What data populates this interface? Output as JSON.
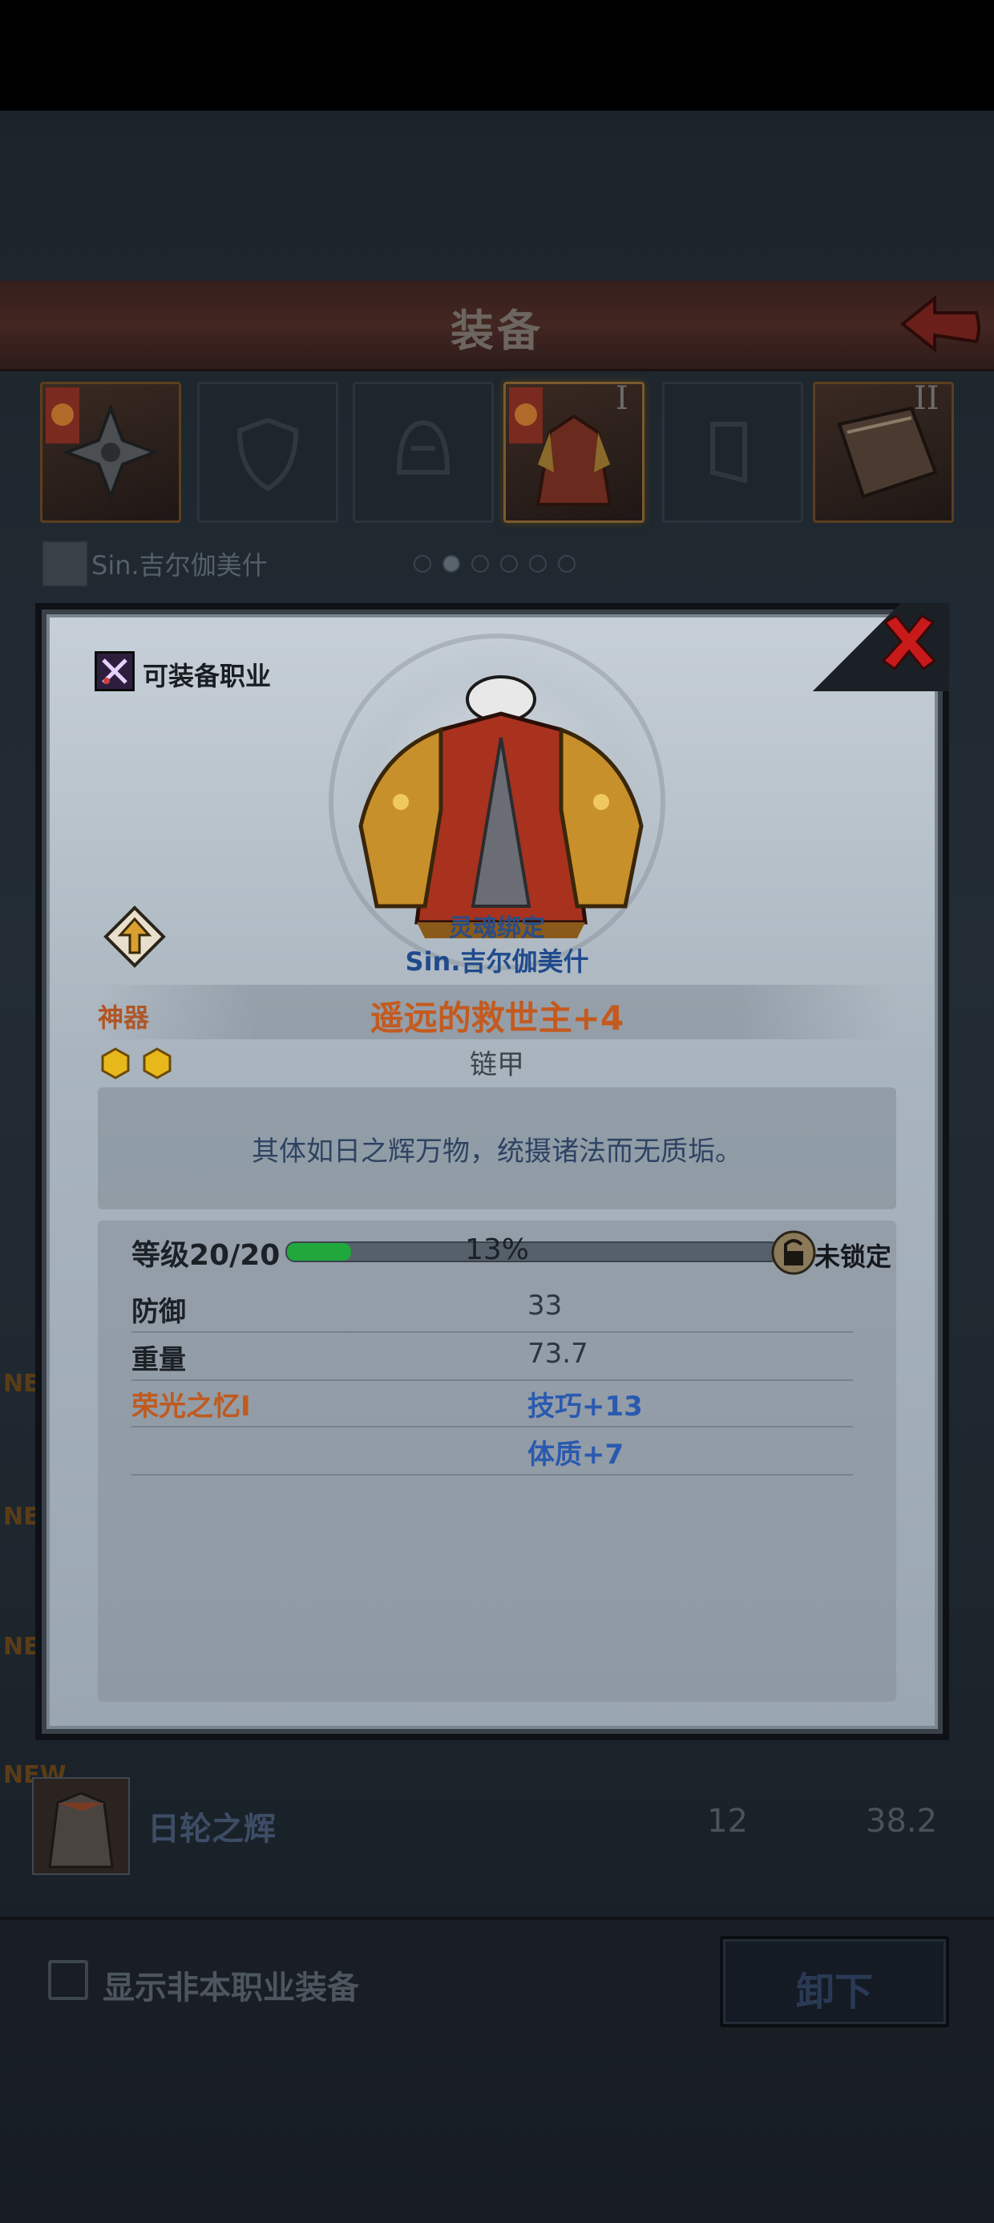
{
  "header": {
    "title": "装备"
  },
  "slots": {
    "roman_1": "I",
    "roman_2": "II"
  },
  "character": {
    "name": "Sin.吉尔伽美什"
  },
  "list": {
    "new_tag": "NEW",
    "bottom_item": {
      "name": "日轮之辉",
      "level": "12",
      "weight": "38.2"
    }
  },
  "footer": {
    "show_non_class_label": "显示非本职业装备",
    "unequip_label": "卸下"
  },
  "modal": {
    "equippable_jobs_label": "可装备职业",
    "soulbound_label": "灵魂绑定",
    "owner": "Sin.吉尔伽美什",
    "rarity": "神器",
    "item_name": "遥远的救世主+4",
    "item_type": "链甲",
    "description": "其体如日之辉万物，统摄诸法而无质垢。",
    "level_text": "等级20/20",
    "xp_percent": 13,
    "xp_percent_text": "13%",
    "lock_status": "未锁定",
    "stats": [
      {
        "label": "防御",
        "value": "33"
      },
      {
        "label": "重量",
        "value": "73.7"
      }
    ],
    "set_bonus": {
      "name": "荣光之忆I",
      "values": [
        "技巧+13",
        "体质+7"
      ]
    }
  }
}
